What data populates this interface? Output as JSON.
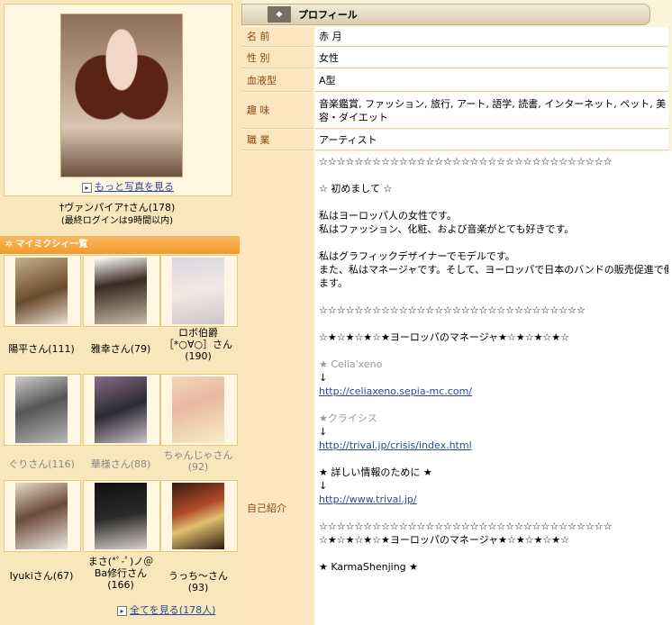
{
  "left": {
    "more_photos": "もっと写真を見る",
    "owner_name": "†ヴァンパイア†さん(178)",
    "last_login": "(最終ログインは9時間以内)",
    "friends_title": "マイミクシィ一覧",
    "friends": [
      {
        "name": "陽平さん(111)",
        "faded": false
      },
      {
        "name": "雅幸さん(79)",
        "faded": false
      },
      {
        "name": "ロボ伯爵［*○∀○］さん(190)",
        "faded": false
      },
      {
        "name": "ぐりさん(116)",
        "faded": true
      },
      {
        "name": "華様さん(88)",
        "faded": true
      },
      {
        "name": "ちゃんじゃさん(92)",
        "faded": true
      },
      {
        "name": "Iyukiさん(67)",
        "faded": false
      },
      {
        "name": "まさ(*ﾟ-ﾟ)ノ＠Ba修行さん(166)",
        "faded": false
      },
      {
        "name": "うっち～さん(93)",
        "faded": false
      }
    ],
    "see_all": "全てを見る(178人)"
  },
  "profile": {
    "title": "プロフィール",
    "rows": [
      {
        "label": "名 前",
        "value": "赤 月"
      },
      {
        "label": "性 別",
        "value": "女性"
      },
      {
        "label": "血液型",
        "value": "A型"
      },
      {
        "label": "趣 味",
        "value": "音楽鑑賞, ファッション, 旅行, アート, 語学, 読書, インターネット, ペット, 美容・ダイエット"
      },
      {
        "label": "職 業",
        "value": "アーティスト"
      }
    ],
    "intro_label": "自己紹介",
    "intro": {
      "stars1": "☆☆☆☆☆☆☆☆☆☆☆☆☆☆☆☆☆☆☆☆☆☆☆☆☆☆☆☆☆☆☆☆☆",
      "greeting": "☆ 初めまして ☆",
      "p1a": "私はヨーロッパ人の女性です。",
      "p1b": "私はファッション、化粧、および音楽がとても好きです。",
      "p2a": "私はグラフィックデザイナーでモデルです。",
      "p2b": "また、私はマネージャです。そして、ヨーロッパで日本のバンドの販売促進で働いてい",
      "p2c": "ます。",
      "stars2": "☆☆☆☆☆☆☆☆☆☆☆☆☆☆☆☆☆☆☆☆☆☆☆☆☆☆☆☆☆☆",
      "manager1": "☆★☆★☆★☆★ヨーロッパのマネージャ★☆★☆★☆★☆",
      "celia_title": "★ Celia'xeno",
      "celia_arrow": "↓",
      "celia_link": "http://celiaxeno.sepia-mc.com/",
      "crisis_title": "★クライシス",
      "crisis_arrow": "↓",
      "crisis_link": "http://trival.jp/crisis/index.html",
      "info_title": "★ 詳しい情報のために ★",
      "info_arrow": "↓",
      "info_link": "http://www.trival.jp/",
      "stars3": "☆☆☆☆☆☆☆☆☆☆☆☆☆☆☆☆☆☆☆☆☆☆☆☆☆☆☆☆☆☆☆☆☆",
      "manager2": "☆★☆★☆★☆★ヨーロッパのマネージャ★☆★☆★☆★☆",
      "karma": "★ KarmaShenjing ★"
    }
  }
}
